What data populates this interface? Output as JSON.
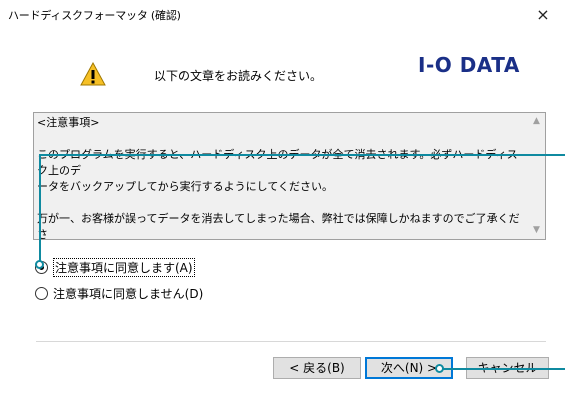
{
  "window": {
    "title": "ハードディスクフォーマッタ (確認)",
    "close_glyph": "×"
  },
  "header": {
    "prompt": "以下の文章をお読みください。",
    "brand": "I-O DATA",
    "warning_glyph": "!"
  },
  "notes": {
    "text": "<注意事項>\n\nこのプログラムを実行すると、ハードディスク上のデータが全て消去されます。必ずハードディスク上のデ\nータをバックアップしてから実行するようにしてください。\n\n万が一、お客様が誤ってデータを消去してしまった場合、弊社では保障しかねますのでご了承くださ\nい。"
  },
  "options": {
    "agree": "注意事項に同意します(A)",
    "disagree": "注意事項に同意しません(D)",
    "selected": "agree"
  },
  "buttons": {
    "back": "< 戻る(B)",
    "next": "次へ(N) >",
    "cancel": "キャンセル"
  },
  "colors": {
    "brand": "#1a2f87",
    "callout": "#0f8aa0",
    "default_button_border": "#0078d7"
  }
}
